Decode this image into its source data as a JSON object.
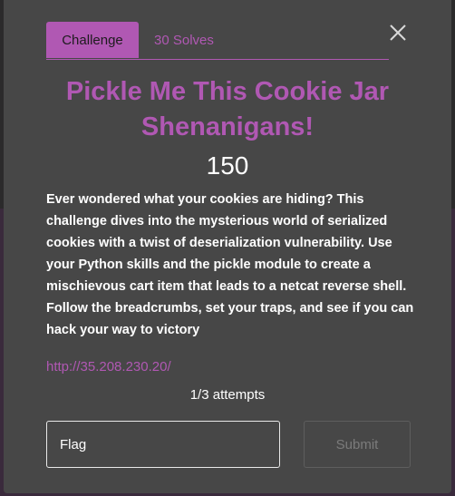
{
  "tabs": [
    {
      "label": "Challenge",
      "active": true
    },
    {
      "label": "30 Solves",
      "active": false
    }
  ],
  "close_icon": "close-icon",
  "challenge": {
    "title": "Pickle Me This Cookie Jar Shenanigans!",
    "points": "150",
    "description": "Ever wondered what your cookies are hiding? This challenge dives into the mysterious world of serialized cookies with a twist of deserialization vulnerability. Use your Python skills and the pickle module to create a mischievous cart item that leads to a netcat reverse shell. Follow the breadcrumbs, set your traps, and see if you can hack your way to victory",
    "link": "http://35.208.230.20/",
    "attempts": "1/3 attempts"
  },
  "form": {
    "flag_placeholder": "Flag",
    "submit_label": "Submit"
  },
  "colors": {
    "accent": "#b058b3",
    "modal_bg": "#474747",
    "text": "#ffffff",
    "disabled_text": "#7b7b7b"
  }
}
